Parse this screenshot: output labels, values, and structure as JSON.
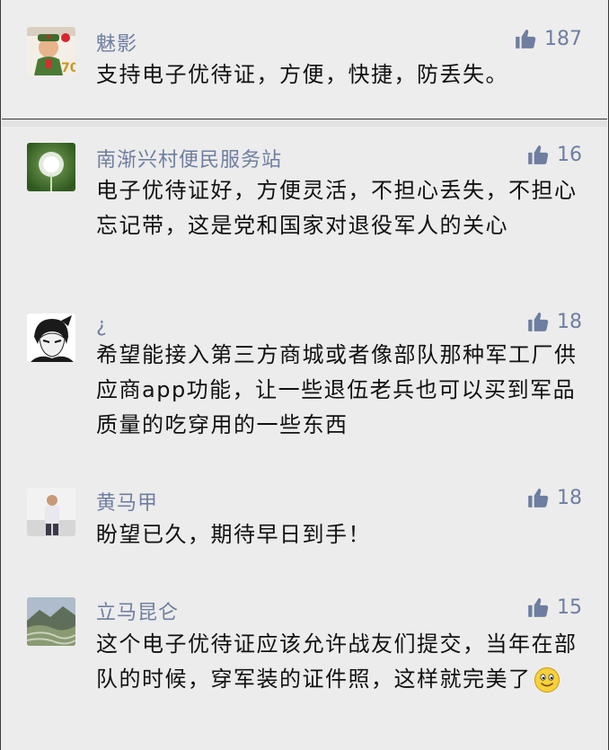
{
  "comments": [
    {
      "name": "魅影",
      "likes": "187",
      "text": "支持电子优待证，方便，快捷，防丢失。",
      "avatar_icon": "soldier-avatar-icon"
    },
    {
      "name": "南渐兴村便民服务站",
      "likes": "16",
      "text": "电子优待证好，方便灵活，不担心丢失，不担心忘记带，这是党和国家对退役军人的关心",
      "avatar_icon": "dandelion-avatar-icon"
    },
    {
      "name": "¿",
      "likes": "18",
      "text": "希望能接入第三方商城或者像部队那种军工厂供应商app功能，让一些退伍老兵也可以买到军品质量的吃穿用的一些东西",
      "avatar_icon": "anime-character-avatar-icon"
    },
    {
      "name": "黄马甲",
      "likes": "18",
      "text": "盼望已久，期待早日到手！",
      "avatar_icon": "person-photo-avatar-icon"
    },
    {
      "name": "立马昆仑",
      "likes": "15",
      "text": "这个电子优待证应该允许战友们提交，当年在部队的时候，穿军装的证件照，这样就完美了",
      "avatar_icon": "landscape-avatar-icon",
      "emoji": "smiling-face-emoji-icon"
    }
  ],
  "colors": {
    "name": "#6f7ea0",
    "text": "#111111",
    "background": "#ededed"
  }
}
